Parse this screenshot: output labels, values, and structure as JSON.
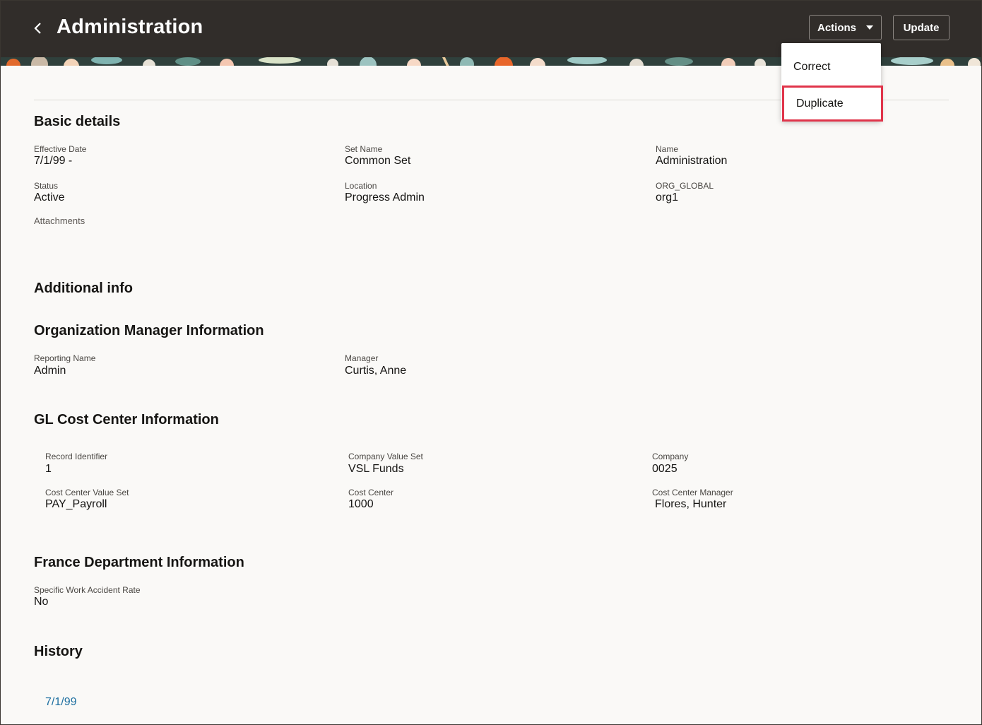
{
  "header": {
    "title": "Administration",
    "actions_label": "Actions",
    "update_label": "Update"
  },
  "menu": {
    "items": [
      "Correct",
      "Duplicate"
    ]
  },
  "basic_details": {
    "heading": "Basic details",
    "effective_date": {
      "label": "Effective Date",
      "value": "7/1/99 -"
    },
    "set_name": {
      "label": "Set Name",
      "value": "Common Set"
    },
    "name": {
      "label": "Name",
      "value": "Administration"
    },
    "status": {
      "label": "Status",
      "value": "Active"
    },
    "location": {
      "label": "Location",
      "value": "Progress Admin"
    },
    "org_global": {
      "label": "ORG_GLOBAL",
      "value": "org1"
    },
    "attachments_label": "Attachments"
  },
  "additional_info": {
    "heading": "Additional info"
  },
  "org_manager": {
    "heading": "Organization Manager Information",
    "reporting_name": {
      "label": "Reporting Name",
      "value": "Admin"
    },
    "manager": {
      "label": "Manager",
      "value": "Curtis, Anne"
    }
  },
  "gl_cost_center": {
    "heading": "GL Cost Center Information",
    "record_identifier": {
      "label": "Record Identifier",
      "value": "1"
    },
    "company_value_set": {
      "label": "Company Value Set",
      "value": "VSL Funds"
    },
    "company": {
      "label": "Company",
      "value": "0025"
    },
    "cost_center_value_set": {
      "label": "Cost Center Value Set",
      "value": "PAY_Payroll"
    },
    "cost_center": {
      "label": "Cost Center",
      "value": "1000"
    },
    "cost_center_manager": {
      "label": "Cost Center Manager",
      "value": "Flores, Hunter"
    }
  },
  "france_dept": {
    "heading": "France Department Information",
    "work_accident_rate": {
      "label": "Specific Work Accident Rate",
      "value": "No"
    }
  },
  "history": {
    "heading": "History",
    "date_link": "7/1/99"
  },
  "colors": {
    "header_bg": "#312d2a",
    "highlight": "#e0344a",
    "link": "#1d6fa0",
    "page_bg": "#faf9f7"
  }
}
